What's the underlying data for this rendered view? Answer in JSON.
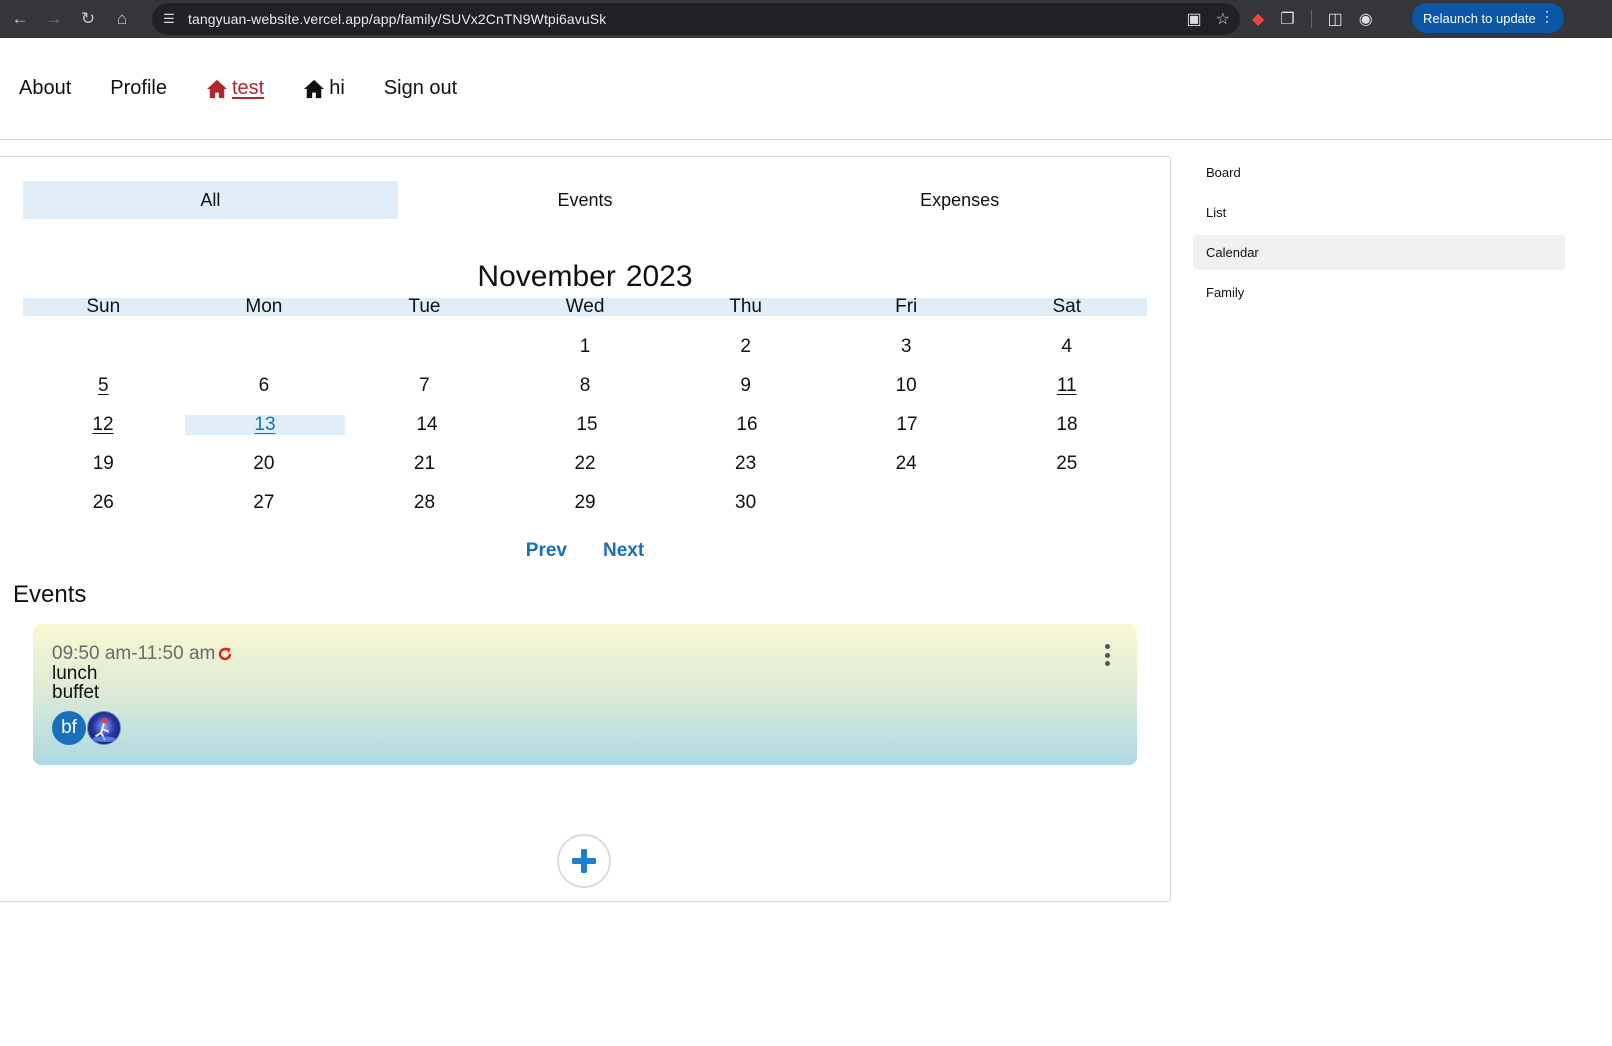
{
  "browser": {
    "url_host": "tangyuan-website.vercel.app",
    "url_path": "/app/family/SUVx2CnTN9Wtpi6avuSk",
    "relaunch_label": "Relaunch to update"
  },
  "topnav": {
    "items": [
      {
        "label": "About"
      },
      {
        "label": "Profile"
      },
      {
        "label": "test",
        "icon": "house-icon",
        "active": true
      },
      {
        "label": "hi",
        "icon": "house-icon"
      },
      {
        "label": "Sign out"
      }
    ]
  },
  "tabs": [
    {
      "label": "All",
      "selected": true
    },
    {
      "label": "Events"
    },
    {
      "label": "Expenses"
    }
  ],
  "calendar": {
    "month": "November",
    "year": "2023",
    "weekdays": [
      "Sun",
      "Mon",
      "Tue",
      "Wed",
      "Thu",
      "Fri",
      "Sat"
    ],
    "weeks": [
      [
        "",
        "",
        "",
        "1",
        "2",
        "3",
        "4"
      ],
      [
        "5",
        "6",
        "7",
        "8",
        "9",
        "10",
        "11"
      ],
      [
        "12",
        "13",
        "14",
        "15",
        "16",
        "17",
        "18"
      ],
      [
        "19",
        "20",
        "21",
        "22",
        "23",
        "24",
        "25"
      ],
      [
        "26",
        "27",
        "28",
        "29",
        "30",
        "",
        ""
      ]
    ],
    "days_with_events": [
      "5",
      "11",
      "12"
    ],
    "selected_day": "13",
    "prev_label": "Prev",
    "next_label": "Next"
  },
  "events_section": {
    "heading": "Events",
    "items": [
      {
        "time": "09:50 am-11:50 am",
        "recurring": true,
        "title": "lunch",
        "description": "buffet",
        "participants": [
          {
            "initials": "bf",
            "color": "#1a6fbc"
          },
          {
            "type": "photo"
          }
        ]
      }
    ]
  },
  "sidebar": {
    "items": [
      {
        "label": "Board"
      },
      {
        "label": "List"
      },
      {
        "label": "Calendar",
        "selected": true
      },
      {
        "label": "Family"
      }
    ]
  },
  "colors": {
    "accent": "#1a6fbc",
    "active_nav": "#b3272e",
    "tab_selected_bg": "#e0eef9",
    "recurring_icon": "#e02020"
  }
}
